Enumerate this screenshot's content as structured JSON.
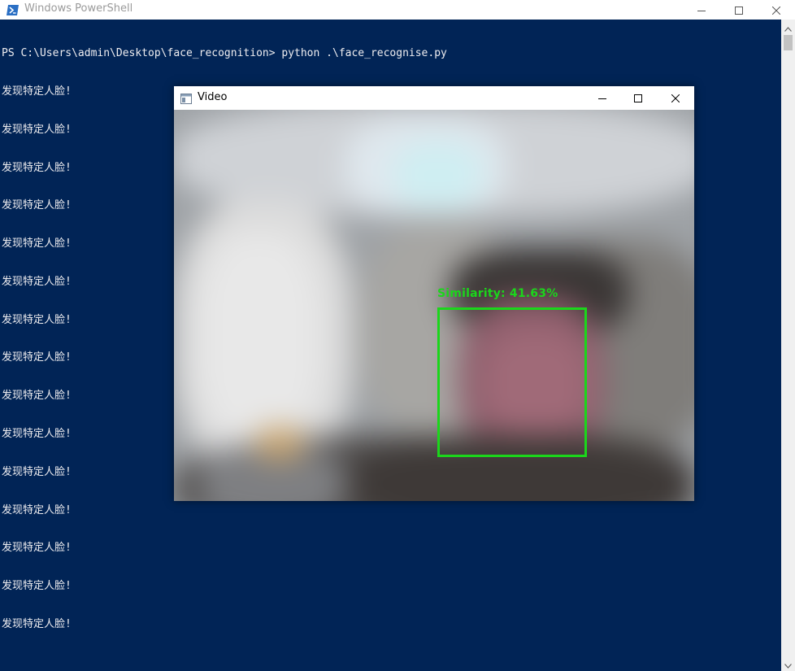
{
  "powershell": {
    "title": "Windows PowerShell",
    "prompt_line": "PS C:\\Users\\admin\\Desktop\\face_recognition> python .\\face_recognise.py",
    "output_lines": [
      "发现特定人脸!",
      "发现特定人脸!",
      "发现特定人脸!",
      "发现特定人脸!",
      "发现特定人脸!",
      "发现特定人脸!",
      "发现特定人脸!",
      "发现特定人脸!",
      "发现特定人脸!",
      "发现特定人脸!",
      "发现特定人脸!",
      "发现特定人脸!",
      "发现特定人脸!",
      "发现特定人脸!",
      "发现特定人脸!"
    ],
    "background_color": "#012456",
    "text_color": "#eeedf0",
    "icon": "powershell-icon"
  },
  "video": {
    "title": "Video",
    "icon": "video-window-icon",
    "similarity_label": "Similarity:  41.63%",
    "detection_color": "#1bd61b"
  },
  "window_controls": {
    "minimize": "minimize-icon",
    "maximize": "maximize-icon",
    "close": "close-icon"
  }
}
